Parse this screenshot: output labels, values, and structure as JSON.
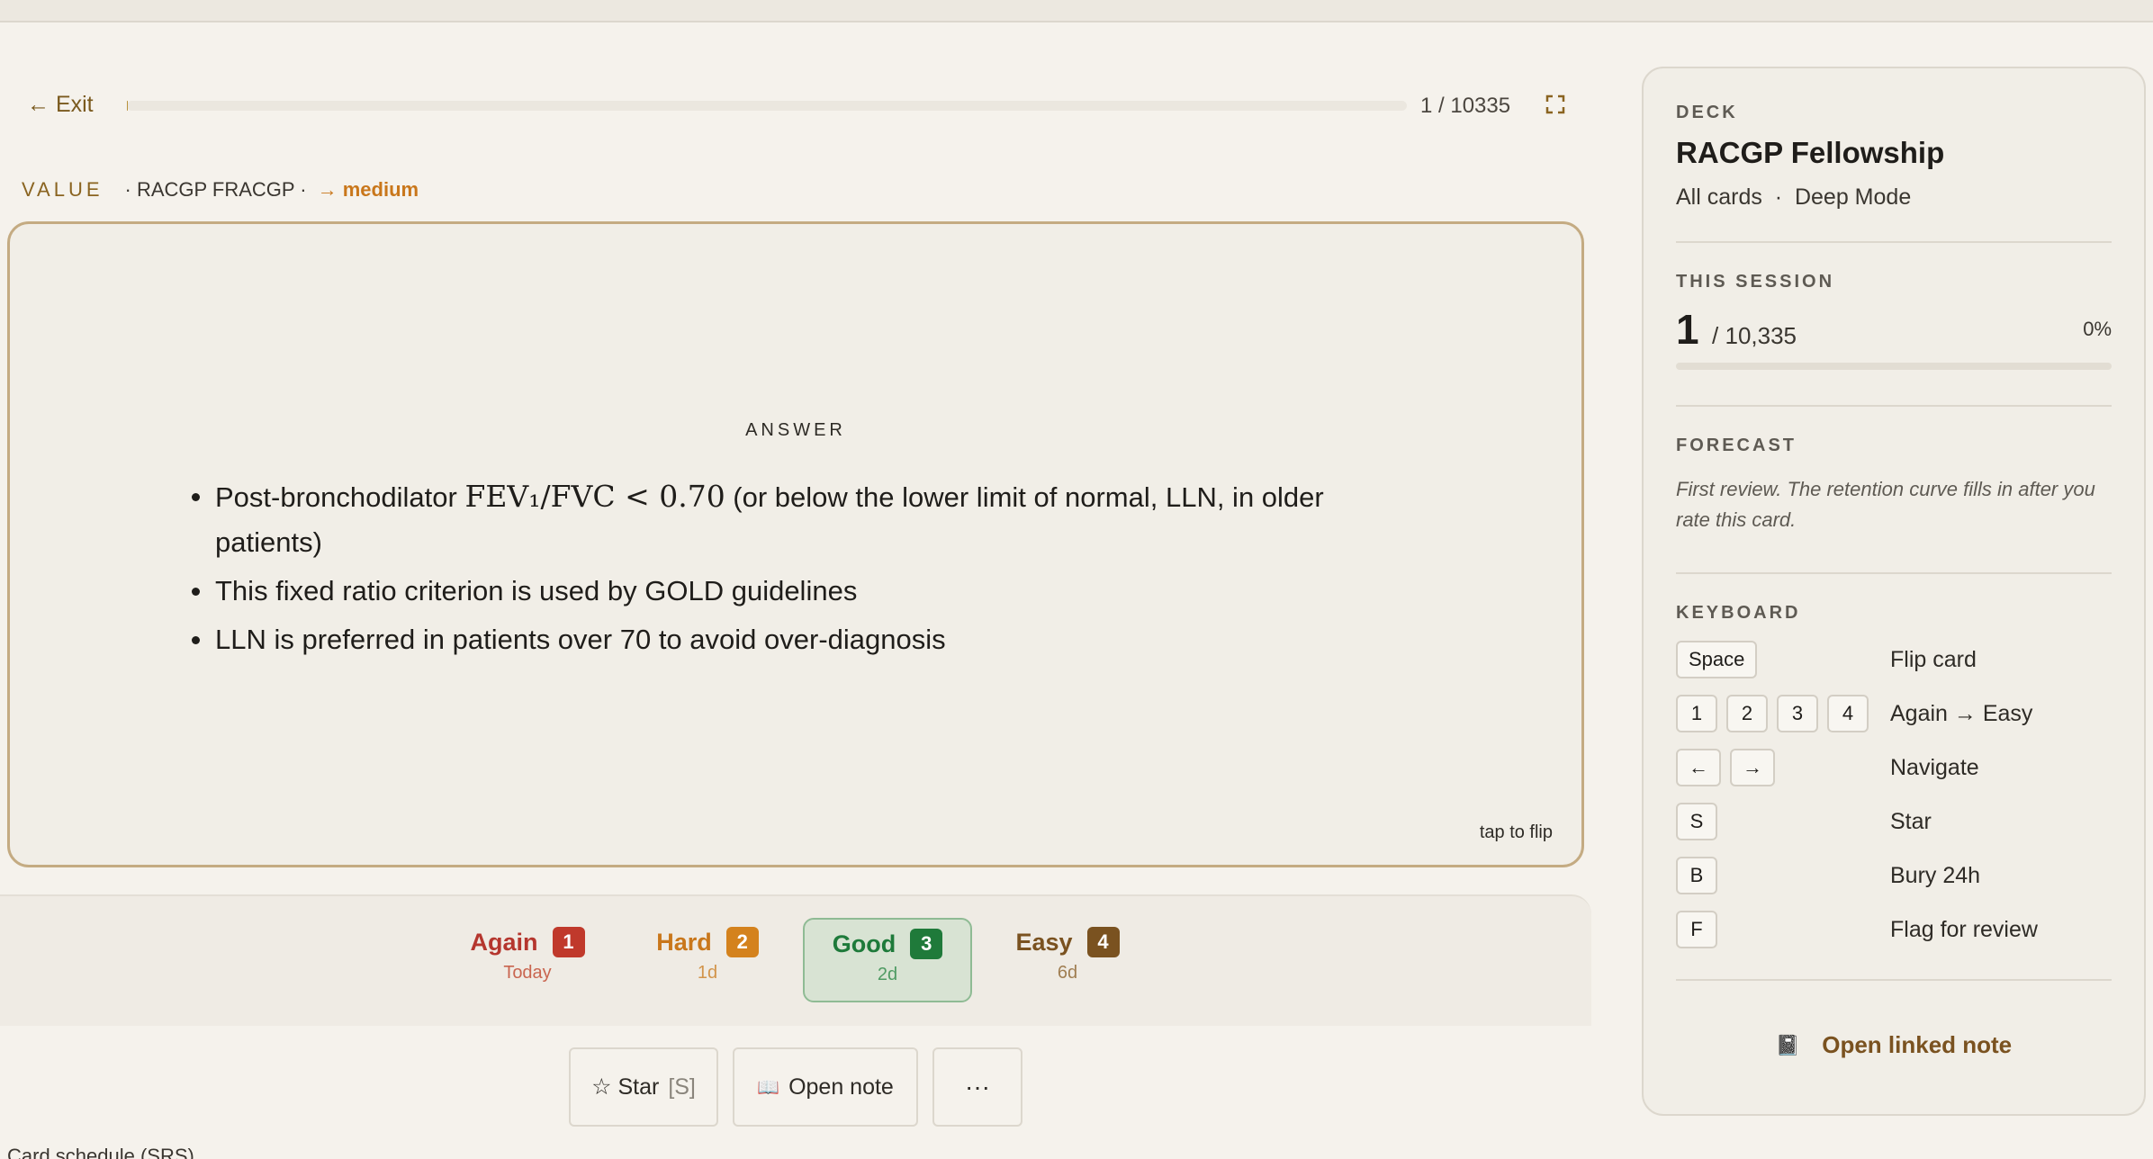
{
  "header": {
    "exit_label": "← Exit",
    "counter": "1 / 10335",
    "progress_fraction": 0.0001
  },
  "card_meta": {
    "type": "VALUE",
    "deck": "· RACGP FRACGP ·",
    "difficulty": "→ medium"
  },
  "card": {
    "section_label": "ANSWER",
    "bullets": {
      "b1_pre": "Post-bronchodilator ",
      "b1_math": "FEV₁/FVC < 0.70",
      "b1_post": " (or below the lower limit of normal, LLN, in older patients)",
      "b2": "This fixed ratio criterion is used by GOLD guidelines",
      "b3": "LLN is preferred in patients over 70 to avoid over-diagnosis"
    },
    "tap_hint": "tap to flip"
  },
  "ratings": [
    {
      "name": "Again",
      "key": "1",
      "interval": "Today"
    },
    {
      "name": "Hard",
      "key": "2",
      "interval": "1d"
    },
    {
      "name": "Good",
      "key": "3",
      "interval": "2d"
    },
    {
      "name": "Easy",
      "key": "4",
      "interval": "6d"
    }
  ],
  "actions": {
    "star_label": "☆ Star",
    "star_shortcut": "[S]",
    "open_note_icon": "📖",
    "open_note_label": "Open note",
    "more_label": "···"
  },
  "schedule_label": "Card schedule (SRS)",
  "sidebar": {
    "deck_heading": "DECK",
    "deck_name": "RACGP Fellowship",
    "deck_sub": "All cards  ·  Deep Mode",
    "session_heading": "THIS SESSION",
    "session_current": "1",
    "session_total": "/ 10,335",
    "session_pct": "0%",
    "forecast_heading": "FORECAST",
    "forecast_text": "First review. The retention curve fills in after you rate this card.",
    "keyboard_heading": "KEYBOARD",
    "shortcuts": [
      {
        "keys": [
          "Space"
        ],
        "action": "Flip card"
      },
      {
        "keys": [
          "1",
          "2",
          "3",
          "4"
        ],
        "action": "Again → Easy"
      },
      {
        "keys": [
          "←",
          "→"
        ],
        "action": "Navigate"
      },
      {
        "keys": [
          "S"
        ],
        "action": "Star"
      },
      {
        "keys": [
          "B"
        ],
        "action": "Bury 24h"
      },
      {
        "keys": [
          "F"
        ],
        "action": "Flag for review"
      }
    ],
    "linked_note_icon": "📓",
    "linked_note_label": "Open linked note"
  },
  "colors": {
    "background": "#f5f2ec",
    "accent_gold": "#8a6420",
    "again": "#c0392b",
    "hard": "#d4821d",
    "good": "#1f7a3a",
    "easy": "#7a5220"
  }
}
